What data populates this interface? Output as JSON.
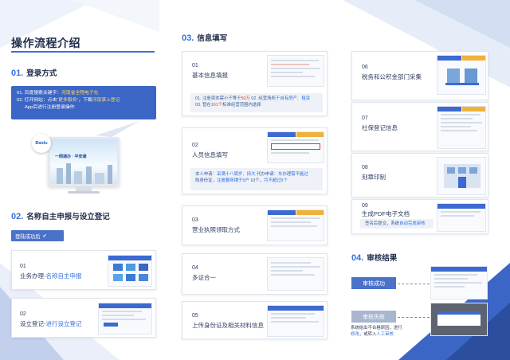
{
  "page": {
    "title": "操作流程介绍"
  },
  "sections": {
    "s01": {
      "num": "01.",
      "label": "登录方式"
    },
    "s02": {
      "num": "02.",
      "label": "名称自主申报与设立登记"
    },
    "s03": {
      "num": "03.",
      "label": "信息填写"
    },
    "s04": {
      "num": "04.",
      "label": "审核结果"
    }
  },
  "login": {
    "line1_a": "01. 百度搜索关键字：",
    "line1_b": "河南省全程电子化",
    "line2_a": "02. 打开网站：点击",
    "line2_b": "“更多服务”",
    "line2_c": "，下载",
    "line2_d": "河南掌上登记",
    "line3": "App后进行注册登录操作",
    "browser_logo": "Baidu",
    "screen_title": "一网通办 · 平安通"
  },
  "step2": {
    "tag": "登陆成功后",
    "tag_icon": "check-icon",
    "card1": {
      "num": "01",
      "title_a": "业务办理-",
      "title_b": "名称自主申报"
    },
    "card2": {
      "num": "02",
      "title_a": "设立登记-",
      "title_b": "进行设立登记"
    }
  },
  "step3": {
    "cards": [
      {
        "num": "01",
        "title": "基本信息填报",
        "desc1_a": "01. 注册资本需小于等于",
        "desc1_b": "50万",
        "desc1_c": " 02. 经营场所",
        "desc1_d": "于自有房产、租赁",
        "desc2_a": "03. 暂在",
        "desc2_b": "161个",
        "desc2_c": "标准经营范围内选择"
      },
      {
        "num": "02",
        "title": "人员信息填写",
        "desc1_a": "本人申请：",
        "desc1_b": "采满十八周岁、持大",
        "desc1_c": " 代办申请：",
        "desc1_d": "车办理需不能过",
        "desc2_a": "陆身份证，",
        "desc2_b": "注册要商铺于5户",
        "desc2_c": " 10个，",
        "desc2_d": "月不超过5个"
      },
      {
        "num": "03",
        "title": "营业执照领取方式"
      },
      {
        "num": "04",
        "title": "多证合一"
      },
      {
        "num": "05",
        "title": "上传身份证及相关材料信息"
      },
      {
        "num": "06",
        "title": "税务和公积金部门采集"
      },
      {
        "num": "07",
        "title": "社保登记信息"
      },
      {
        "num": "08",
        "title": "刻章印制"
      },
      {
        "num": "09",
        "title": "生成PDF电子文档",
        "desc_a": "签名后提交，系统",
        "desc_b": "自动完成审核"
      }
    ]
  },
  "step4": {
    "success": "审核成功",
    "fail": "审核失败",
    "note_a": "系统给出不合格原因，",
    "note_b": "进行",
    "note_c": "修改",
    "note_d": "，或转入",
    "note_e": "人工审核"
  },
  "colors": {
    "accent": "#3b66c5",
    "highlight": "#e0392b",
    "link": "#2f6fe0"
  }
}
